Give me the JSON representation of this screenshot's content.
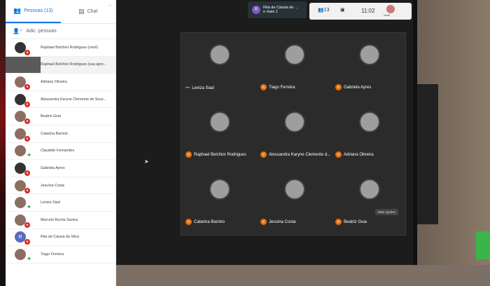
{
  "tabs": {
    "people": "Pessoas (13)",
    "chat": "Chat"
  },
  "add_people": "Adic. pessoas",
  "participants": [
    {
      "name": "Raphael Belchior Rodrigues (você)",
      "type": "dark"
    },
    {
      "name": "Raphael Belchior Rodrigues (sua apre...",
      "type": "video"
    },
    {
      "name": "Adriana Oliveira",
      "type": "photo"
    },
    {
      "name": "Alessandra Karyne Clemente de Souz...",
      "type": "dark"
    },
    {
      "name": "Beatriz Guia",
      "type": "photo"
    },
    {
      "name": "Catarina Barreto",
      "type": "photo"
    },
    {
      "name": "Claudete Fernandes",
      "type": "photo"
    },
    {
      "name": "Gabriela Ayres",
      "type": "dark"
    },
    {
      "name": "Jesuína Costa",
      "type": "photo"
    },
    {
      "name": "Leniza Siad",
      "type": "photo"
    },
    {
      "name": "Marcelo Rocha Santos",
      "type": "photo"
    },
    {
      "name": "Rita de Cássia da Silva",
      "type": "initial",
      "initial": "R"
    },
    {
      "name": "Tiago Ferreira",
      "type": "photo"
    }
  ],
  "meeting": {
    "chip_initial": "R",
    "chip_line1": "Rita de Cássia de ...",
    "chip_line2": "e mais 1",
    "count": "13",
    "time": "11:02",
    "you_label": "Você",
    "more_button": "Mais opções"
  },
  "tiles": [
    {
      "name": "Leniza Siad",
      "speaking": true
    },
    {
      "name": "Tiago Ferreira"
    },
    {
      "name": "Gabriela Ayres"
    },
    {
      "name": "Raphael Belchior Rodrigues"
    },
    {
      "name": "Alessandra Karyne Clemente d..."
    },
    {
      "name": "Adriana Oliveira"
    },
    {
      "name": "Catarina Barreto"
    },
    {
      "name": "Jesuína Costa"
    },
    {
      "name": "Beatriz Guia"
    }
  ]
}
